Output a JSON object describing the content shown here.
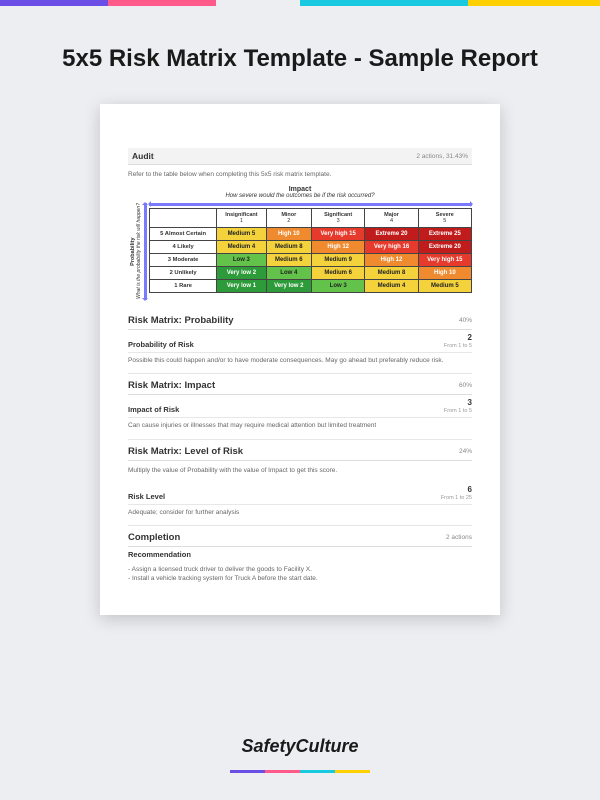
{
  "pageTitle": "5x5 Risk Matrix Template - Sample Report",
  "brand": "SafetyCulture",
  "audit": {
    "title": "Audit",
    "meta": "2 actions, 31.43%"
  },
  "refer": "Refer to the table below when completing this 5x5 risk matrix template.",
  "impact": {
    "heading": "Impact",
    "sub": "How severe would the outcomes be if the risk occurred?"
  },
  "probability": {
    "heading": "Probability",
    "sub": "What is the probability the risk will happen?"
  },
  "cols": [
    {
      "name": "Insignificant",
      "n": "1"
    },
    {
      "name": "Minor",
      "n": "2"
    },
    {
      "name": "Significant",
      "n": "3"
    },
    {
      "name": "Major",
      "n": "4"
    },
    {
      "name": "Severe",
      "n": "5"
    }
  ],
  "rows": [
    {
      "name": "5 Almost Certain",
      "cells": [
        "Medium 5",
        "High 10",
        "Very high 15",
        "Extreme 20",
        "Extreme 25"
      ]
    },
    {
      "name": "4 Likely",
      "cells": [
        "Medium 4",
        "Medium 8",
        "High 12",
        "Very high 16",
        "Extreme 20"
      ]
    },
    {
      "name": "3 Moderate",
      "cells": [
        "Low 3",
        "Medium 6",
        "Medium 9",
        "High 12",
        "Very high 15"
      ]
    },
    {
      "name": "2 Unlikely",
      "cells": [
        "Very low 2",
        "Low 4",
        "Medium 6",
        "Medium 8",
        "High 10"
      ]
    },
    {
      "name": "1 Rare",
      "cells": [
        "Very low 1",
        "Very low 2",
        "Low 3",
        "Medium 4",
        "Medium 5"
      ]
    }
  ],
  "cellClasses": [
    [
      "c-m",
      "c-h",
      "c-vh",
      "c-e",
      "c-e"
    ],
    [
      "c-m",
      "c-m",
      "c-h",
      "c-vh",
      "c-e"
    ],
    [
      "c-l",
      "c-m",
      "c-m",
      "c-h",
      "c-vh"
    ],
    [
      "c-vl",
      "c-l",
      "c-m",
      "c-m",
      "c-h"
    ],
    [
      "c-vl",
      "c-vl",
      "c-l",
      "c-m",
      "c-m"
    ]
  ],
  "s1": {
    "title": "Risk Matrix: Probability",
    "pct": "40%"
  },
  "s1row": {
    "label": "Probability of Risk",
    "val": "2",
    "sub": "From 1 to 5"
  },
  "s1note": "Possible this could happen and/or to have moderate consequences. May go ahead but preferably reduce risk.",
  "s2": {
    "title": "Risk Matrix: Impact",
    "pct": "60%"
  },
  "s2row": {
    "label": "Impact of Risk",
    "val": "3",
    "sub": "From 1 to 5"
  },
  "s2note": "Can cause injuries or illnesses that may require medical attention but limited treatment",
  "s3": {
    "title": "Risk Matrix: Level of Risk",
    "pct": "24%"
  },
  "s3instr": "Multiply the value of Probability with the value of Impact to get this score.",
  "s3row": {
    "label": "Risk Level",
    "val": "6",
    "sub": "From 1 to 25"
  },
  "s3note": "Adequate; consider for further analysis",
  "s4": {
    "title": "Completion",
    "meta": "2 actions"
  },
  "rec": {
    "label": "Recommendation",
    "l1": "- Assign a licensed truck driver to deliver the goods to Facility X.",
    "l2": "- Install a vehicle tracking system for Truck A before the start date."
  },
  "chart_data": {
    "type": "heatmap",
    "title": "5x5 Risk Matrix",
    "xlabel": "Impact — How severe would the outcomes be if the risk occurred?",
    "ylabel": "Probability — What is the probability the risk will happen?",
    "x_categories": [
      "Insignificant 1",
      "Minor 2",
      "Significant 3",
      "Major 4",
      "Severe 5"
    ],
    "y_categories": [
      "5 Almost Certain",
      "4 Likely",
      "3 Moderate",
      "2 Unlikely",
      "1 Rare"
    ],
    "values": [
      [
        5,
        10,
        15,
        20,
        25
      ],
      [
        4,
        8,
        12,
        16,
        20
      ],
      [
        3,
        6,
        9,
        12,
        15
      ],
      [
        2,
        4,
        6,
        8,
        10
      ],
      [
        1,
        2,
        3,
        4,
        5
      ]
    ],
    "labels": [
      [
        "Medium 5",
        "High 10",
        "Very high 15",
        "Extreme 20",
        "Extreme 25"
      ],
      [
        "Medium 4",
        "Medium 8",
        "High 12",
        "Very high 16",
        "Extreme 20"
      ],
      [
        "Low 3",
        "Medium 6",
        "Medium 9",
        "High 12",
        "Very high 15"
      ],
      [
        "Very low 2",
        "Low 4",
        "Medium 6",
        "Medium 8",
        "High 10"
      ],
      [
        "Very low 1",
        "Very low 2",
        "Low 3",
        "Medium 4",
        "Medium 5"
      ]
    ]
  }
}
